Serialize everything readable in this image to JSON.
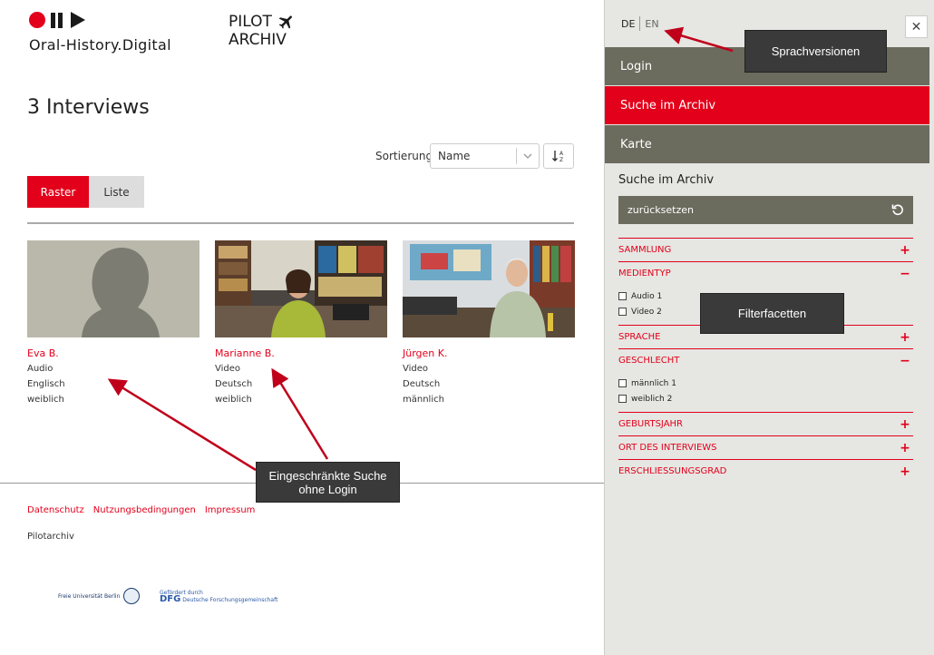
{
  "brand": {
    "oh_logo_text": "Oral-History.Digital",
    "pilot_line1": "PILOT",
    "pilot_line2": "ARCHIV"
  },
  "main": {
    "heading": "3 Interviews",
    "sort_label": "Sortierung",
    "sort_value": "Name",
    "view_tabs": [
      {
        "label": "Raster",
        "active": true
      },
      {
        "label": "Liste",
        "active": false
      }
    ],
    "interviews": [
      {
        "name": "Eva B.",
        "media": "Audio",
        "language": "Englisch",
        "gender": "weiblich"
      },
      {
        "name": "Marianne B.",
        "media": "Video",
        "language": "Deutsch",
        "gender": "weiblich"
      },
      {
        "name": "Jürgen K.",
        "media": "Video",
        "language": "Deutsch",
        "gender": "männlich"
      }
    ]
  },
  "footer": {
    "links": [
      "Datenschutz",
      "Nutzungsbedingungen",
      "Impressum"
    ],
    "site_name": "Pilotarchiv",
    "fu_logo": "Freie Universität Berlin",
    "dfg_logo_small": "Gefördert durch",
    "dfg_logo_big": "DFG",
    "dfg_logo_text": "Deutsche Forschungsgemeinschaft"
  },
  "sidebar": {
    "lang_de": "DE",
    "lang_en": "EN",
    "close_icon": "close-icon",
    "nav": {
      "login": "Login",
      "search": "Suche im Archiv",
      "map": "Karte"
    },
    "search_title": "Suche im Archiv",
    "reset_label": "zurücksetzen",
    "facets": [
      {
        "label": "SAMMLUNG",
        "expanded": false,
        "options": []
      },
      {
        "label": "MEDIENTYP",
        "expanded": true,
        "options": [
          "Audio 1",
          "Video 2"
        ]
      },
      {
        "label": "SPRACHE",
        "expanded": false,
        "options": []
      },
      {
        "label": "GESCHLECHT",
        "expanded": true,
        "options": [
          "männlich 1",
          "weiblich 2"
        ]
      },
      {
        "label": "GEBURTSJAHR",
        "expanded": false,
        "options": []
      },
      {
        "label": "ORT DES INTERVIEWS",
        "expanded": false,
        "options": []
      },
      {
        "label": "ERSCHLIESSUNGSGRAD",
        "expanded": false,
        "options": []
      }
    ],
    "toggle_open": "−",
    "toggle_closed": "+"
  },
  "annotations": {
    "sprachversionen": "Sprachversionen",
    "filterfacetten": "Filterfacetten",
    "eingeschraenkt_line1": "Eingeschränkte Suche",
    "eingeschraenkt_line2": "ohne Login"
  },
  "colors": {
    "accent": "#e3001b",
    "nav_grey": "#6b6b5e",
    "sidebar_bg": "#e6e6e2"
  }
}
